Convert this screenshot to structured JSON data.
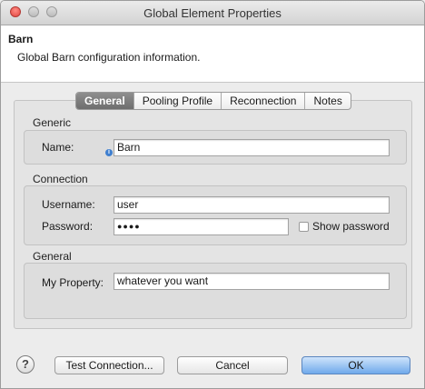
{
  "window": {
    "title": "Global Element Properties"
  },
  "header": {
    "title": "Barn",
    "description": "Global Barn configuration information."
  },
  "tabs": [
    {
      "label": "General",
      "active": true
    },
    {
      "label": "Pooling Profile",
      "active": false
    },
    {
      "label": "Reconnection",
      "active": false
    },
    {
      "label": "Notes",
      "active": false
    }
  ],
  "generic": {
    "label": "Generic",
    "name_label": "Name:",
    "name_value": "Barn",
    "info_icon": "info-icon"
  },
  "connection": {
    "label": "Connection",
    "username_label": "Username:",
    "username_value": "user",
    "password_label": "Password:",
    "password_value": "●●●●",
    "show_password_label": "Show password",
    "show_password_checked": false
  },
  "general": {
    "label": "General",
    "my_property_label": "My Property:",
    "my_property_value": "whatever you want"
  },
  "footer": {
    "help_icon": "?",
    "test_connection_label": "Test Connection...",
    "cancel_label": "Cancel",
    "ok_label": "OK"
  },
  "colors": {
    "accent": "#6fa9eb",
    "active_tab": "#7a7a7a",
    "info": "#3f7fcf"
  }
}
